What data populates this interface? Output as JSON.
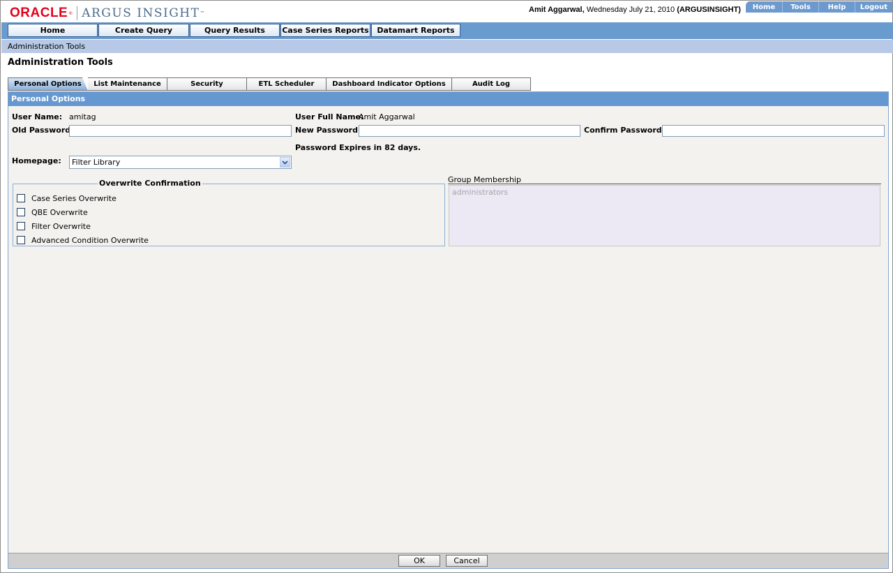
{
  "brand": {
    "company": "ORACLE",
    "product": "ARGUS INSIGHT",
    "trademark": "™"
  },
  "user_info": {
    "name": "Amit Aggarwal,",
    "date": "Wednesday July 21, 2010",
    "instance": "(ARGUSINSIGHT)"
  },
  "top_links": [
    "Home",
    "Tools",
    "Help",
    "Logout"
  ],
  "nav": [
    "Home",
    "Create Query",
    "Query Results",
    "Case Series Reports",
    "Datamart Reports"
  ],
  "breadcrumb": "Administration Tools",
  "page_title": "Administration Tools",
  "tabs": [
    "Personal Options",
    "List Maintenance",
    "Security",
    "ETL Scheduler",
    "Dashboard Indicator Options",
    "Audit Log"
  ],
  "panel": {
    "title": "Personal Options",
    "user_name_label": "User Name:",
    "user_name": "amitag",
    "full_name_label": "User Full Name:",
    "full_name": "Amit Aggarwal",
    "old_password_label": "Old Password",
    "old_password_value": "",
    "new_password_label": "New Password:",
    "new_password_value": "",
    "confirm_password_label": "Confirm Password:",
    "confirm_password_value": "",
    "password_expiry": "Password Expires in 82 days.",
    "homepage_label": "Homepage:",
    "homepage_value": "Filter Library",
    "overwrite_title": "Overwrite Confirmation",
    "overwrite_options": [
      {
        "label": "Case Series Overwrite",
        "checked": false
      },
      {
        "label": "QBE Overwrite",
        "checked": false
      },
      {
        "label": "Filter Overwrite",
        "checked": false
      },
      {
        "label": "Advanced Condition Overwrite",
        "checked": false
      }
    ],
    "group_label": "Group Membership",
    "groups": [
      "administrators"
    ]
  },
  "buttons": {
    "ok": "OK",
    "cancel": "Cancel"
  },
  "colors": {
    "nav_bar": "#6a9bcf",
    "panel_header": "#6598d0",
    "breadcrumb_bg": "#b7c9e6",
    "oracle_red": "#e4001b",
    "panel_bg": "#f4f2ee",
    "group_box": "#ece8f4"
  }
}
